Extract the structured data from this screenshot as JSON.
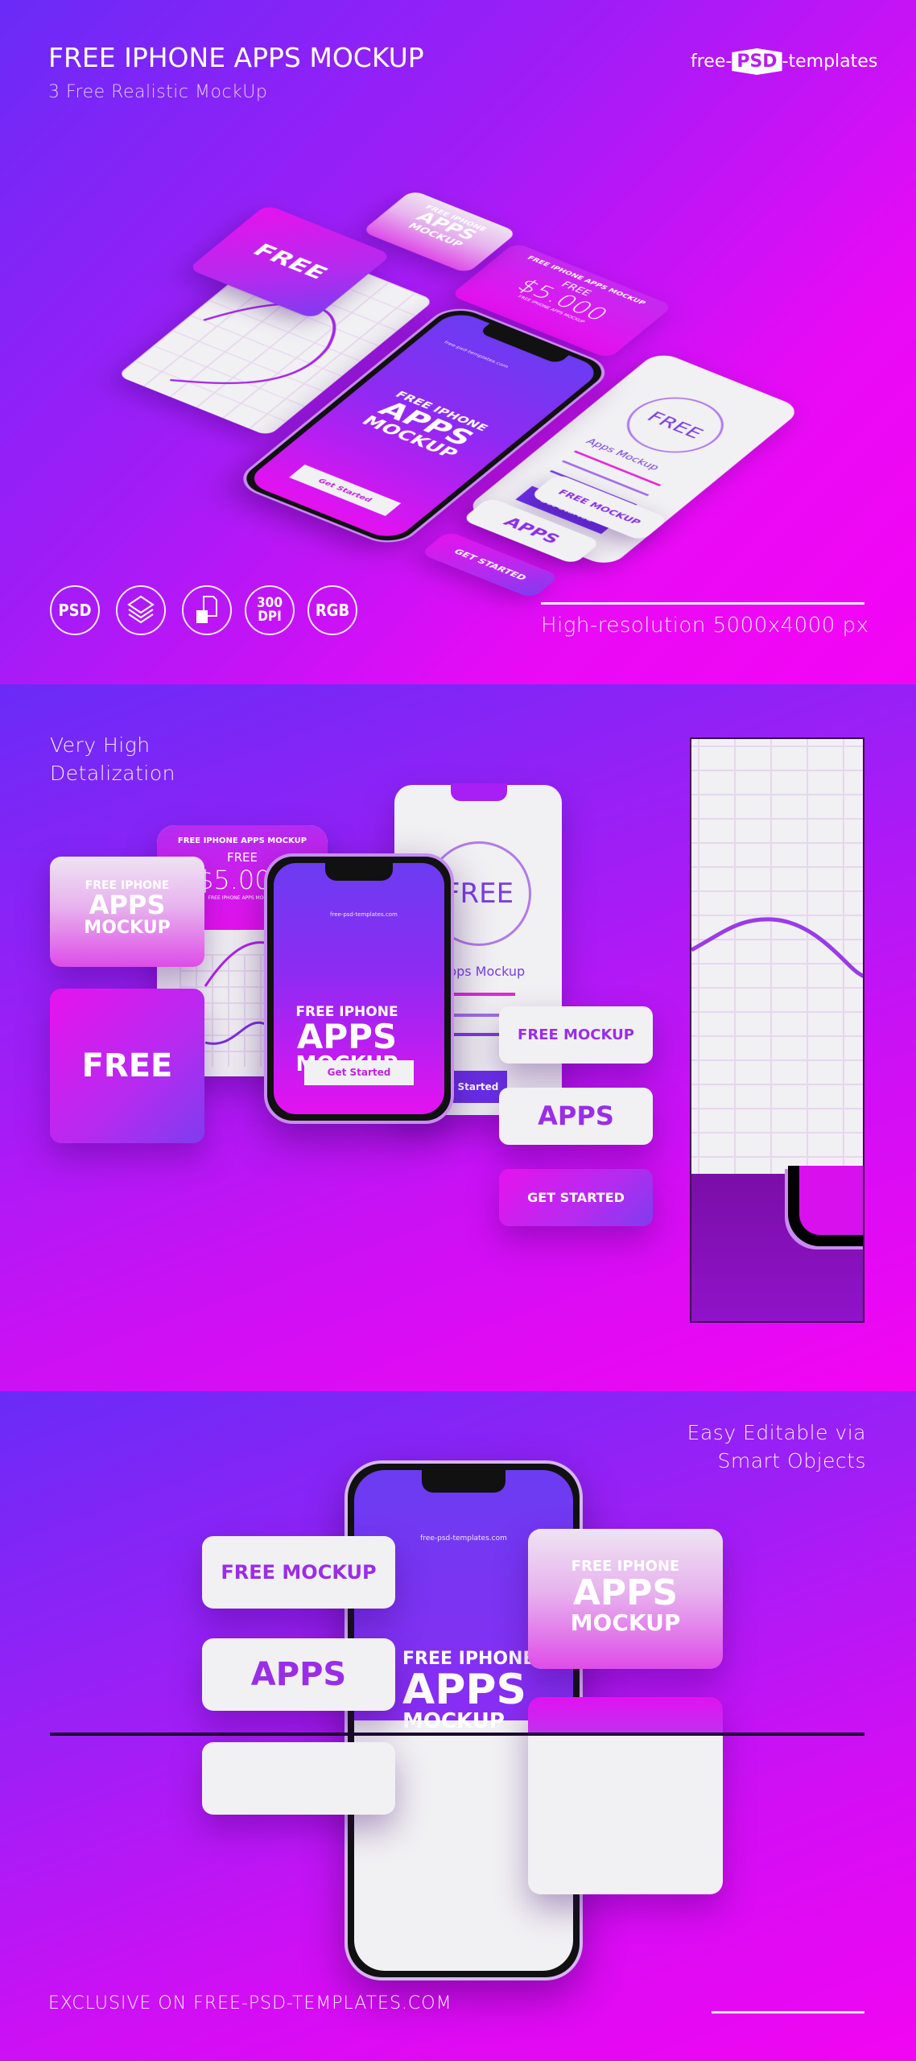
{
  "header": {
    "title": "FREE IPHONE APPS MOCKUP",
    "subtitle": "3 Free Realistic MockUp",
    "logo": {
      "left": "free-",
      "badge": "PSD",
      "right": "-templates"
    }
  },
  "section1": {
    "feature_icons": [
      {
        "name": "psd-icon",
        "label": "PSD"
      },
      {
        "name": "layers-icon",
        "label": ""
      },
      {
        "name": "smart-object-icon",
        "label": ""
      },
      {
        "name": "dpi-icon",
        "label": "300\nDPI",
        "line1": "300",
        "line2": "DPI"
      },
      {
        "name": "rgb-icon",
        "label": "RGB"
      }
    ],
    "resolution": "High-resolution 5000x4000 px",
    "cards": {
      "pink_card": [
        "FREE IPHONE",
        "APPS",
        "MOCKUP"
      ],
      "free_card": "FREE",
      "price_card": {
        "heading": "FREE IPHONE APPS  MOCKUP",
        "label": "FREE",
        "price": "$5.000",
        "caption": "FREE IPHONE APPS  MOCKUP"
      },
      "phone_screen": {
        "url": "free-psd-templates.com",
        "title1": "FREE IPHONE",
        "title2": "APPS",
        "title3": "MOCKUP",
        "button": "Get Started"
      },
      "white_screen": {
        "circle": "FREE",
        "subtitle": "Apps Mockup",
        "button": "Get Started"
      },
      "free_mockup": "FREE MOCKUP",
      "apps": "APPS",
      "get_started": "GET STARTED"
    }
  },
  "section2": {
    "caption_line1": "Very High",
    "caption_line2": "Detalization",
    "cards": {
      "pink_card": [
        "FREE IPHONE",
        "APPS",
        "MOCKUP"
      ],
      "free_card": "FREE",
      "price_card": {
        "heading": "FREE IPHONE APPS  MOCKUP",
        "label": "FREE",
        "price": "$5.000",
        "caption": "FREE IPHONE APPS  MOCKUP"
      },
      "phone_screen": {
        "url": "free-psd-templates.com",
        "title1": "FREE IPHONE",
        "title2": "APPS",
        "title3": "MOCKUP",
        "button": "Get Started"
      },
      "white_screen": {
        "circle": "FREE",
        "subtitle": "Apps Mockup",
        "button": "Get Started"
      },
      "free_mockup": "FREE MOCKUP",
      "apps": "APPS",
      "get_started": "GET STARTED"
    }
  },
  "section3": {
    "caption_line1": "Easy Editable via",
    "caption_line2": "Smart Objects",
    "cards": {
      "phone_screen": {
        "url": "free-psd-templates.com",
        "title1": "FREE IPHONE",
        "title2": "APPS",
        "title3": "MOCKUP"
      },
      "free_mockup": "FREE MOCKUP",
      "apps": "APPS",
      "pink_card": [
        "FREE IPHONE",
        "APPS",
        "MOCKUP"
      ]
    }
  },
  "footer": {
    "text": "EXCLUSIVE ON FREE-PSD-TEMPLATES.COM"
  },
  "colors": {
    "accent_purple": "#6a2bf7",
    "accent_magenta": "#f305f3",
    "card_text_purple": "#9a2ee6"
  }
}
